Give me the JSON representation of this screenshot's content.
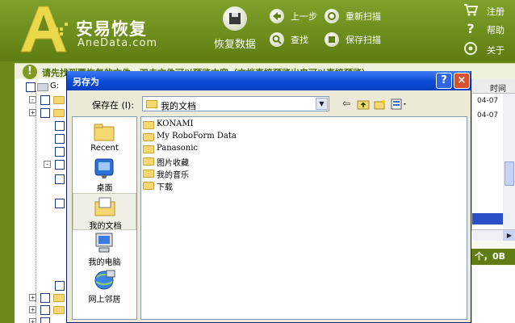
{
  "app": {
    "name": "安易恢复",
    "domain": "AneData.com",
    "recover_label": "恢复数据",
    "toolbar": {
      "prev_step": "上一步",
      "rescan": "重新扫描",
      "find": "查找",
      "save_scan": "保存扫描"
    },
    "side_links": {
      "register": "注册",
      "help": "帮助",
      "about": "关于"
    },
    "tip": "请先找到要恢复的文件，双击文件可以预览内容（文档直接预览出来可以直接预览）",
    "brand_color": "#6d8a1a"
  },
  "tree": {
    "drive_label": "G:",
    "expanders": [
      "-",
      "+",
      "-",
      "+",
      "+",
      "+",
      "-"
    ]
  },
  "right_list": {
    "header": "时间",
    "dates": [
      "04-07",
      "04-07"
    ],
    "status": "个，0B"
  },
  "dialog": {
    "title": "另存为",
    "help_button": "?",
    "close_button": "×",
    "save_in_label": "保存在 (I):",
    "save_in_value": "我的文档",
    "tools": {
      "back_icon": "back-arrow-icon",
      "up_icon": "up-folder-icon",
      "new_folder_icon": "new-folder-icon",
      "view_icon": "view-menu-icon"
    },
    "places": [
      {
        "label": "Recent",
        "icon": "recent-folder-icon"
      },
      {
        "label": "桌面",
        "icon": "desktop-icon"
      },
      {
        "label": "我的文档",
        "icon": "my-documents-icon"
      },
      {
        "label": "我的电脑",
        "icon": "my-computer-icon"
      },
      {
        "label": "网上邻居",
        "icon": "network-places-icon"
      }
    ],
    "files": [
      "KONAMI",
      "My RoboForm Data",
      "Panasonic",
      "图片收藏",
      "我的音乐",
      "下载"
    ]
  }
}
